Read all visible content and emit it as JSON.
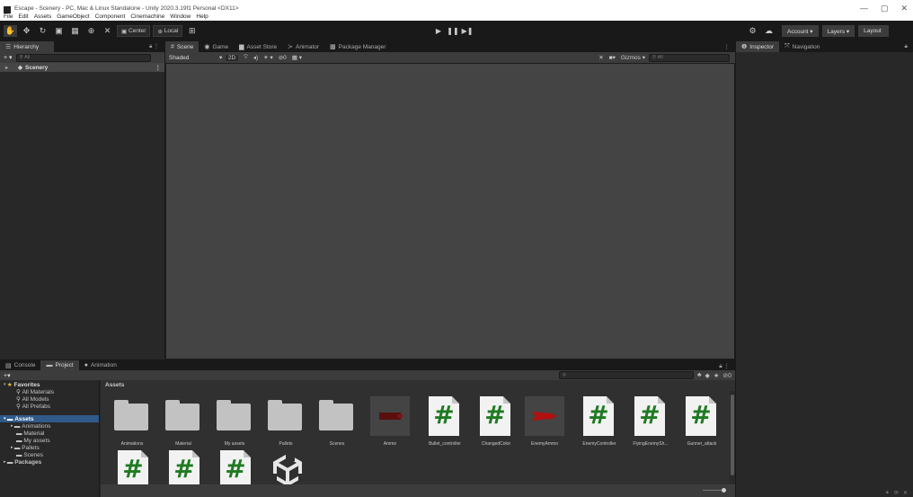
{
  "window": {
    "title": "Escape - Scenery - PC, Mac & Linux Standalone - Unity 2020.3.19f1 Personal <DX11>",
    "controls": [
      "—",
      "▢",
      "✕"
    ]
  },
  "menu": [
    "File",
    "Edit",
    "Assets",
    "GameObject",
    "Component",
    "Cinemachine",
    "Window",
    "Help"
  ],
  "toolbar": {
    "pivot_label": "Center",
    "space_label": "Local",
    "account_label": "Account ▾",
    "layers_label": "Layers ▾",
    "layout_label": "Layout",
    "play_icon": "▶",
    "pause_icon": "❚❚",
    "step_icon": "▶❚"
  },
  "hierarchy": {
    "tab_label": "Hierarchy",
    "add_label": "+ ▾",
    "search_placeholder": "All",
    "scene_item": "Scenery"
  },
  "scene": {
    "tabs": [
      "Scene",
      "Game",
      "Asset Store",
      "Animator",
      "Package Manager"
    ],
    "shading": "Shaded",
    "mode_2d": "2D",
    "fx_count": "0",
    "gizmos_label": "Gizmos ▾",
    "search_placeholder": "All"
  },
  "inspector": {
    "tabs": [
      "Inspector",
      "Navigation"
    ]
  },
  "project": {
    "tabs": [
      "Console",
      "Project",
      "Animation"
    ],
    "favorites_label": "Favorites",
    "favorites": [
      "All Materials",
      "All Models",
      "All Prefabs"
    ],
    "assets_label": "Assets",
    "asset_folders": [
      "Animations",
      "Material",
      "My assets",
      "Pallets",
      "Scenes"
    ],
    "packages_label": "Packages",
    "breadcrumb": "Assets",
    "hidden_count": "0",
    "items": [
      {
        "label": "Animations",
        "kind": "folder"
      },
      {
        "label": "Material",
        "kind": "folder"
      },
      {
        "label": "My assets",
        "kind": "folder"
      },
      {
        "label": "Pallets",
        "kind": "folder"
      },
      {
        "label": "Scenes",
        "kind": "folder"
      },
      {
        "label": "Ammo",
        "kind": "sprite",
        "color": "#5a0f0f"
      },
      {
        "label": "Bullet_controller",
        "kind": "script"
      },
      {
        "label": "ChangedColor",
        "kind": "script"
      },
      {
        "label": "EnemyAmmo",
        "kind": "sprite",
        "color": "#b01010"
      },
      {
        "label": "EnemyController",
        "kind": "script"
      },
      {
        "label": "FlyingEnemySh...",
        "kind": "script"
      },
      {
        "label": "Gunner_attack",
        "kind": "script"
      },
      {
        "label": "",
        "kind": "script"
      },
      {
        "label": "",
        "kind": "script"
      },
      {
        "label": "",
        "kind": "script"
      },
      {
        "label": "",
        "kind": "unity"
      }
    ]
  },
  "colors": {
    "accent_selection": "#2f5a8a",
    "script_green": "#1f7a22",
    "panel_bg": "#282828"
  }
}
